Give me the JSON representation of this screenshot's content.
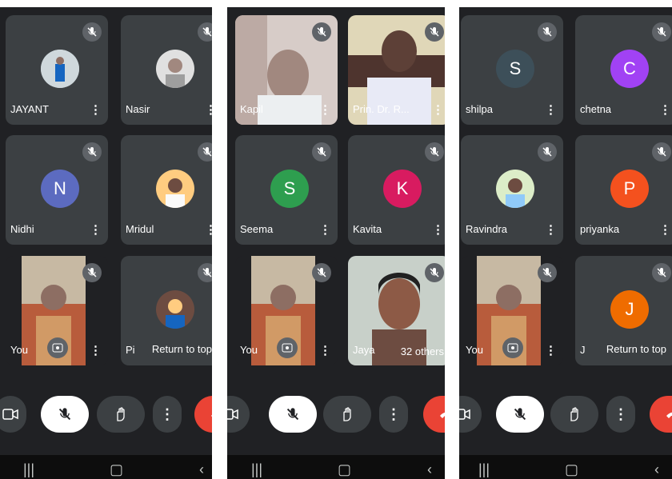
{
  "screens": [
    {
      "tiles": [
        {
          "name": "JAYANT",
          "kind": "photo-avatar"
        },
        {
          "name": "Nasir",
          "kind": "photo-avatar"
        },
        {
          "name": "Nidhi",
          "kind": "letter",
          "letter": "N",
          "color": "#5c6bc0"
        },
        {
          "name": "Mridul",
          "kind": "photo-avatar"
        },
        {
          "name": "You",
          "kind": "self-video"
        },
        {
          "name": "Pi",
          "kind": "photo-avatar",
          "toast": "Return to top"
        }
      ]
    },
    {
      "tiles": [
        {
          "name": "Kapil",
          "kind": "video"
        },
        {
          "name": "Prin. Dr. R...",
          "kind": "video"
        },
        {
          "name": "Seema",
          "kind": "letter",
          "letter": "S",
          "color": "#2e9e4f"
        },
        {
          "name": "Kavita",
          "kind": "letter",
          "letter": "K",
          "color": "#d81b60"
        },
        {
          "name": "You",
          "kind": "self-video"
        },
        {
          "name": "Jaya",
          "kind": "video",
          "others": "32 others"
        }
      ]
    },
    {
      "tiles": [
        {
          "name": "shilpa",
          "kind": "letter",
          "letter": "S",
          "color": "#3d4f59"
        },
        {
          "name": "chetna",
          "kind": "letter",
          "letter": "C",
          "color": "#a142f4"
        },
        {
          "name": "Ravindra",
          "kind": "photo-avatar"
        },
        {
          "name": "priyanka",
          "kind": "letter",
          "letter": "P",
          "color": "#f4511e"
        },
        {
          "name": "You",
          "kind": "self-video"
        },
        {
          "name": "J",
          "kind": "letter",
          "letter": "J",
          "color": "#ef6c00",
          "toast": "Return to top"
        }
      ]
    }
  ],
  "colors": {
    "background": "#202124",
    "tile": "#3c4043",
    "hangup": "#ea4335",
    "mic_button": "#ffffff"
  },
  "controls": [
    "camera-icon",
    "mic-off-icon",
    "raise-hand-icon",
    "more-options-icon",
    "end-call-icon"
  ],
  "navbar": [
    "recent-apps-icon",
    "home-icon",
    "back-icon"
  ]
}
